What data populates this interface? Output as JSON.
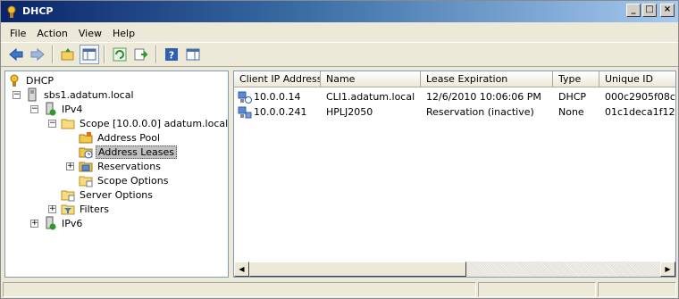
{
  "window": {
    "title": "DHCP"
  },
  "menu": {
    "file": "File",
    "action": "Action",
    "view": "View",
    "help": "Help"
  },
  "toolbar": {
    "buttons": [
      "back-icon",
      "forward-icon",
      "up-folder-icon",
      "show-hide-tree-icon",
      "refresh-icon",
      "export-list-icon",
      "help-icon",
      "properties-view-icon"
    ]
  },
  "tree": {
    "root": "DHCP",
    "server": "sbs1.adatum.local",
    "ipv4": "IPv4",
    "scope": "Scope [10.0.0.0] adatum.local",
    "address_pool": "Address Pool",
    "address_leases": "Address Leases",
    "reservations": "Reservations",
    "scope_options": "Scope Options",
    "server_options": "Server Options",
    "filters": "Filters",
    "ipv6": "IPv6"
  },
  "list": {
    "columns": [
      "Client IP Address",
      "Name",
      "Lease Expiration",
      "Type",
      "Unique ID"
    ],
    "rows": [
      {
        "ip": "10.0.0.14",
        "name": "CLI1.adatum.local",
        "expiration": "12/6/2010 10:06:06 PM",
        "type": "DHCP",
        "uid": "000c2905f08c",
        "icon": "lease-client-icon"
      },
      {
        "ip": "10.0.0.241",
        "name": "HPLJ2050",
        "expiration": "Reservation (inactive)",
        "type": "None",
        "uid": "01c1deca1f12",
        "icon": "reservation-client-icon"
      }
    ]
  },
  "colors": {
    "title_start": "#0a246a",
    "title_end": "#a6caf0",
    "chrome": "#ece9d8",
    "border": "#7f9db9"
  }
}
